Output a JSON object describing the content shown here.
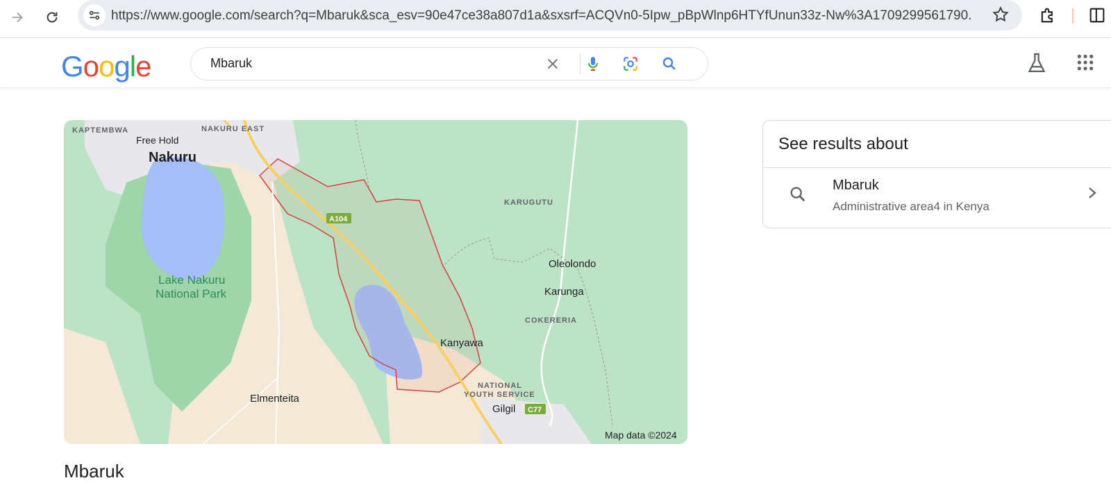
{
  "browser": {
    "url": "https://www.google.com/search?q=Mbaruk&sca_esv=90e47ce38a807d1a&sxsrf=ACQVn0-5Ipw_pBpWlnp6HTYfUnun33z-Nw%3A1709299561790...",
    "icons": [
      "forward-icon",
      "reload-icon",
      "site-info-icon",
      "star-icon",
      "extensions-icon",
      "side-panel-icon"
    ]
  },
  "header": {
    "logo": "Google",
    "query": "Mbaruk",
    "icons": [
      "clear-icon",
      "mic-icon",
      "lens-icon",
      "search-icon",
      "labs-icon",
      "apps-icon"
    ]
  },
  "map": {
    "labels": {
      "kaptembwa": "KAPTEMBWA",
      "nakuru_east": "NAKURU EAST",
      "free_hold": "Free Hold",
      "nakuru": "Nakuru",
      "karugutu": "KARUGUTU",
      "a104": "A104",
      "lake_line1": "Lake Nakuru",
      "lake_line2": "National Park",
      "oleolondo": "Oleolondo",
      "karunga": "Karunga",
      "cokereria": "COKERERIA",
      "kanyawa": "Kanyawa",
      "nys_line1": "NATIONAL",
      "nys_line2": "YOUTH SERVICE",
      "elmenteita": "Elmenteita",
      "gilgil": "Gilgil",
      "c77": "C77",
      "attribution": "Map data ©2024"
    },
    "colors": {
      "green": "#bde3c7",
      "park": "#9ed6a9",
      "lake": "#a4bef7",
      "sand": "#f4e8d6",
      "urban": "#e8e8ea",
      "road": "#f7cf63",
      "boundary": "#d3423f"
    }
  },
  "panel": {
    "title": "See results about",
    "result_title": "Mbaruk",
    "result_subtitle": "Administrative area4 in Kenya"
  },
  "main": {
    "entity_title": "Mbaruk"
  }
}
